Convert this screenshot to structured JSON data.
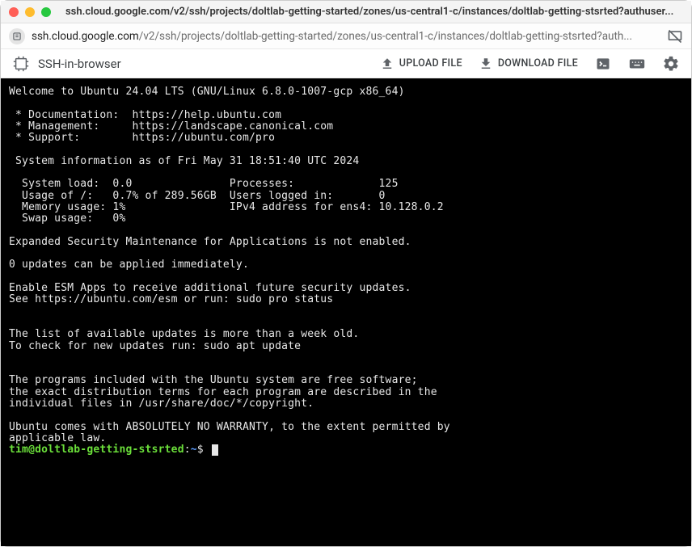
{
  "window": {
    "title": "ssh.cloud.google.com/v2/ssh/projects/doltlab-getting-started/zones/us-central1-c/instances/doltlab-getting-stsrted?authuser..."
  },
  "address": {
    "host": "ssh.cloud.google.com",
    "path": "/v2/ssh/projects/doltlab-getting-started/zones/us-central1-c/instances/doltlab-getting-stsrted?auth..."
  },
  "toolbar": {
    "app_title": "SSH-in-browser",
    "upload_label": "UPLOAD FILE",
    "download_label": "DOWNLOAD FILE"
  },
  "terminal": {
    "body": "Welcome to Ubuntu 24.04 LTS (GNU/Linux 6.8.0-1007-gcp x86_64)\n\n * Documentation:  https://help.ubuntu.com\n * Management:     https://landscape.canonical.com\n * Support:        https://ubuntu.com/pro\n\n System information as of Fri May 31 18:51:40 UTC 2024\n\n  System load:  0.0               Processes:             125\n  Usage of /:   0.7% of 289.56GB  Users logged in:       0\n  Memory usage: 1%                IPv4 address for ens4: 10.128.0.2\n  Swap usage:   0%\n\nExpanded Security Maintenance for Applications is not enabled.\n\n0 updates can be applied immediately.\n\nEnable ESM Apps to receive additional future security updates.\nSee https://ubuntu.com/esm or run: sudo pro status\n\n\nThe list of available updates is more than a week old.\nTo check for new updates run: sudo apt update\n\n\nThe programs included with the Ubuntu system are free software;\nthe exact distribution terms for each program are described in the\nindividual files in /usr/share/doc/*/copyright.\n\nUbuntu comes with ABSOLUTELY NO WARRANTY, to the extent permitted by\napplicable law.\n",
    "prompt_user": "tim@doltlab-getting-stsrted",
    "prompt_sep": ":",
    "prompt_path": "~",
    "prompt_dollar": "$"
  }
}
